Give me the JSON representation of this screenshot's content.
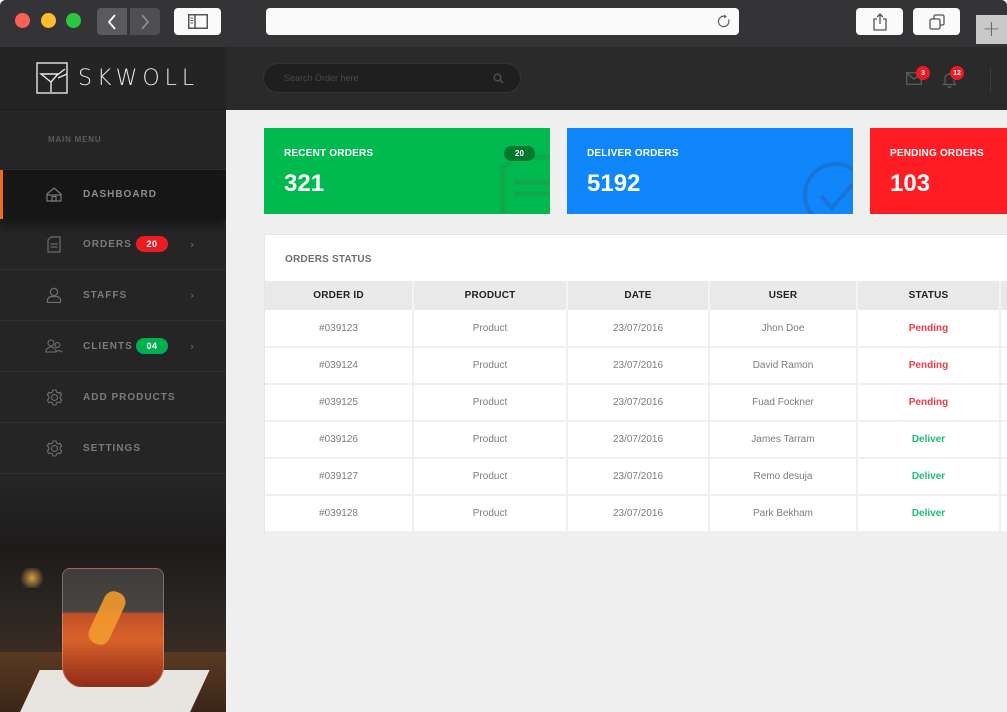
{
  "browser": {
    "address": "",
    "new_tab_label": "+"
  },
  "brand": {
    "name": "SKWOLL"
  },
  "search": {
    "placeholder": "Search Order here",
    "value": ""
  },
  "notifications": {
    "mail_count": "3",
    "bell_count": "12"
  },
  "sidebar": {
    "heading": "MAIN MENU",
    "items": [
      {
        "label": "DASHBOARD",
        "icon": "home-icon",
        "active": true
      },
      {
        "label": "ORDERS",
        "icon": "document-icon",
        "badge": "20",
        "badge_color": "#ed1c24",
        "chevron": "›"
      },
      {
        "label": "STAFFS",
        "icon": "user-icon",
        "chevron": "›"
      },
      {
        "label": "CLIENTS",
        "icon": "users-icon",
        "badge": "04",
        "badge_color": "#00b050",
        "chevron": "›"
      },
      {
        "label": "ADD PRODUCTS",
        "icon": "gear-icon"
      },
      {
        "label": "SETTINGS",
        "icon": "gear-icon"
      }
    ]
  },
  "stats": [
    {
      "title": "RECENT ORDERS",
      "value": "321",
      "badge": "20",
      "color": "#00b94f",
      "icon": "document-icon"
    },
    {
      "title": "DELIVER ORDERS",
      "value": "5192",
      "color": "#0f86fa",
      "icon": "check-circle-icon"
    },
    {
      "title": "PENDING ORDERS",
      "value": "103",
      "color": "#ff1c22"
    }
  ],
  "orders": {
    "title": "ORDERS STATUS",
    "columns": [
      "ORDER ID",
      "PRODUCT",
      "DATE",
      "USER",
      "STATUS",
      ""
    ],
    "rows": [
      {
        "id": "#039123",
        "product": "Product",
        "date": "23/07/2016",
        "user": "Jhon Doe",
        "status": "Pending"
      },
      {
        "id": "#039124",
        "product": "Product",
        "date": "23/07/2016",
        "user": "David Ramon",
        "status": "Pending"
      },
      {
        "id": "#039125",
        "product": "Product",
        "date": "23/07/2016",
        "user": "Fuad Fockner",
        "status": "Pending"
      },
      {
        "id": "#039126",
        "product": "Product",
        "date": "23/07/2016",
        "user": "James Tarram",
        "status": "Deliver"
      },
      {
        "id": "#039127",
        "product": "Product",
        "date": "23/07/2016",
        "user": "Remo desuja",
        "status": "Deliver"
      },
      {
        "id": "#039128",
        "product": "Product",
        "date": "23/07/2016",
        "user": "Park Bekham",
        "status": "Deliver"
      }
    ],
    "status_colors": {
      "Pending": "#f03a47",
      "Deliver": "#1ebf7a"
    }
  }
}
